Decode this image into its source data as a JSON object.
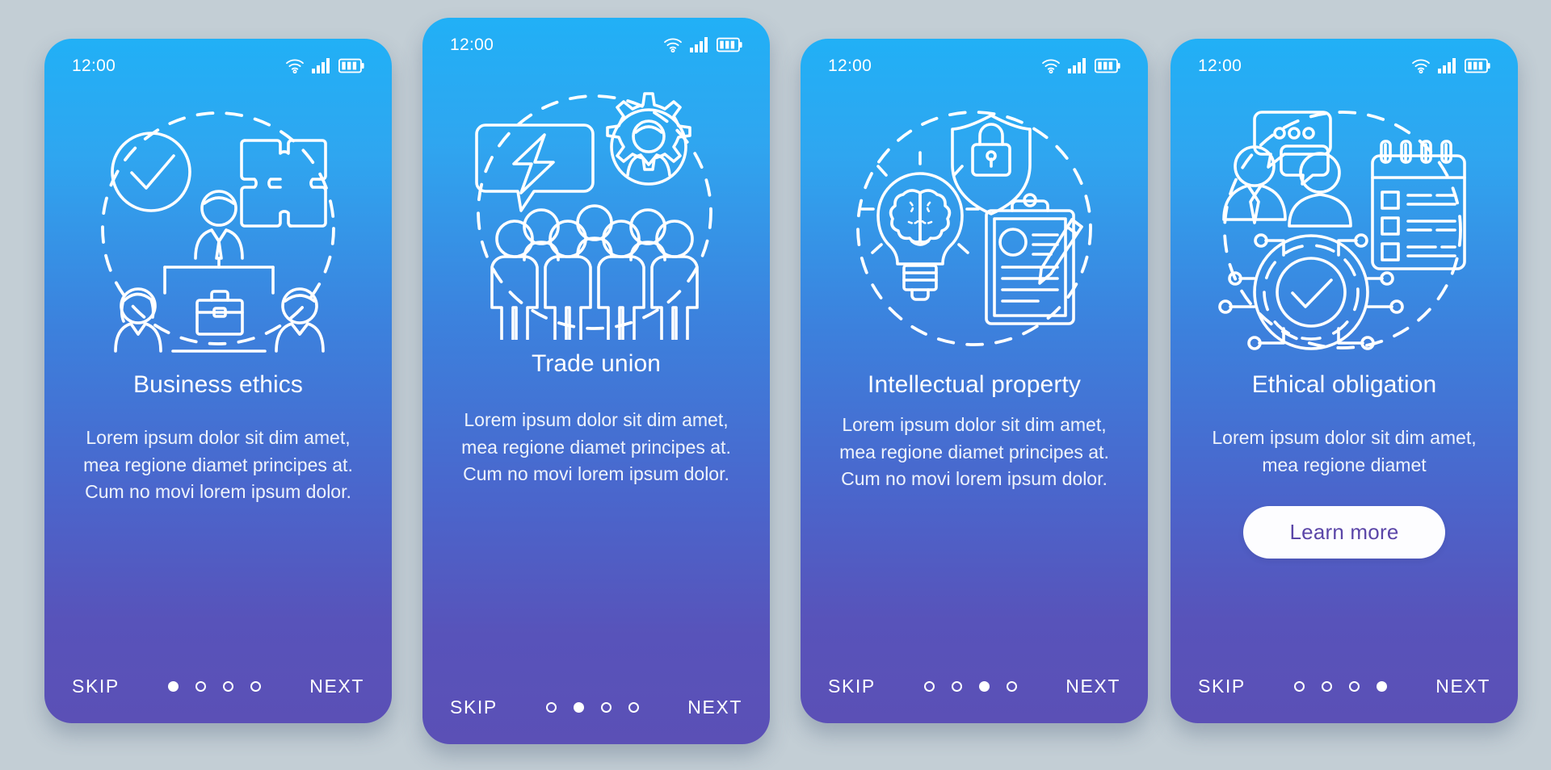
{
  "theme": {
    "background": "#c3ced5",
    "gradient_top": "#21b0f6",
    "gradient_bottom": "#5b50b6",
    "accent_text": "#ffffff",
    "button_bg": "#fdfdff",
    "button_text": "#5b46a8"
  },
  "statusbar": {
    "time": "12:00",
    "icons": [
      "wifi-icon",
      "cellular-signal-icon",
      "battery-icon"
    ]
  },
  "footer": {
    "skip_label": "SKIP",
    "next_label": "NEXT",
    "total_dots": 4
  },
  "screens": [
    {
      "id": "business-ethics",
      "title": "Business ethics",
      "body": "Lorem ipsum dolor sit dim amet, mea regione diamet principes at. Cum no movi lorem ipsum dolor.",
      "illustration": "business-ethics-illustration",
      "active_dot": 1,
      "has_learn_more": false,
      "learn_more_label": ""
    },
    {
      "id": "trade-union",
      "title": "Trade union",
      "body": "Lorem ipsum dolor sit dim amet, mea regione diamet principes at. Cum no movi lorem ipsum dolor.",
      "illustration": "trade-union-illustration",
      "active_dot": 2,
      "has_learn_more": false,
      "learn_more_label": ""
    },
    {
      "id": "intellectual-property",
      "title": "Intellectual property",
      "body": "Lorem ipsum dolor sit dim amet, mea regione diamet principes at. Cum no movi lorem ipsum dolor.",
      "illustration": "intellectual-property-illustration",
      "active_dot": 3,
      "has_learn_more": false,
      "learn_more_label": ""
    },
    {
      "id": "ethical-obligation",
      "title": "Ethical obligation",
      "body": "Lorem ipsum dolor sit dim amet, mea regione diamet",
      "illustration": "ethical-obligation-illustration",
      "active_dot": 4,
      "has_learn_more": true,
      "learn_more_label": "Learn more"
    }
  ]
}
